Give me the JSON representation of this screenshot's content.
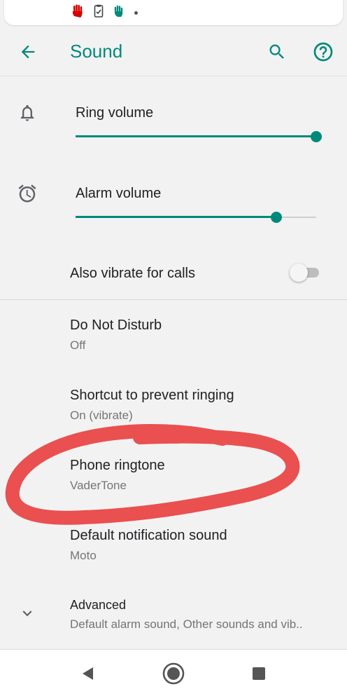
{
  "colors": {
    "accent": "#00897b",
    "annotation": "#e9504f"
  },
  "status_bar": {
    "icons": [
      "red-hand-icon",
      "clipboard-check-icon",
      "waving-hand-icon",
      "more-dot-icon"
    ]
  },
  "toolbar": {
    "title": "Sound",
    "back_icon": "arrow-back-icon",
    "search_icon": "search-icon",
    "help_icon": "help-icon"
  },
  "volume": {
    "ring": {
      "label": "Ring volume",
      "level": 1.0,
      "icon": "bell-icon"
    },
    "alarm": {
      "label": "Alarm volume",
      "level": 0.833,
      "icon": "alarm-clock-icon"
    }
  },
  "vibrate": {
    "label": "Also vibrate for calls",
    "enabled": false
  },
  "settings": [
    {
      "key": "dnd",
      "label": "Do Not Disturb",
      "summary": "Off"
    },
    {
      "key": "shortcut",
      "label": "Shortcut to prevent ringing",
      "summary": "On (vibrate)"
    },
    {
      "key": "ringtone",
      "label": "Phone ringtone",
      "summary": "VaderTone"
    },
    {
      "key": "notification",
      "label": "Default notification sound",
      "summary": "Moto"
    }
  ],
  "advanced": {
    "label": "Advanced",
    "summary": "Default alarm sound, Other sounds and vib..",
    "icon": "chevron-down-icon"
  },
  "nav": {
    "back_icon": "nav-back-icon",
    "home_icon": "nav-home-icon",
    "recents_icon": "nav-recents-icon"
  }
}
